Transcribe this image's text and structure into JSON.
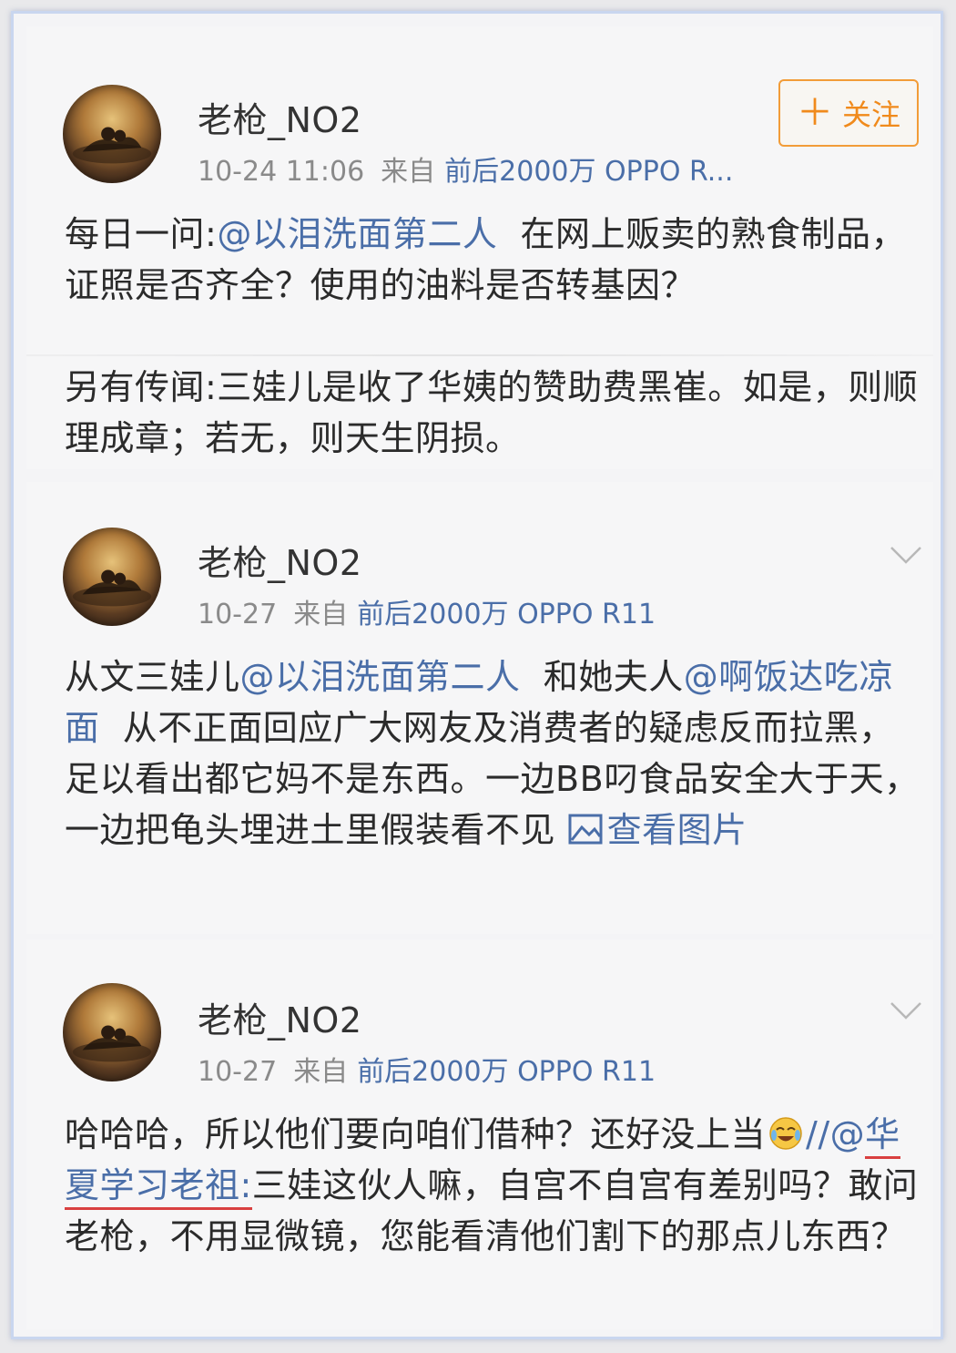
{
  "colors": {
    "link": "#4a6ea8",
    "follow": "#f08a1c",
    "underline": "#d94040",
    "meta": "#8a8a8a"
  },
  "posts": [
    {
      "username": "老枪_NO2",
      "time": "10-24 11:06",
      "source_label": "来自",
      "device": "前后2000万 OPPO R...",
      "follow_label": "关注",
      "body": {
        "p1_prefix": "每日一问:",
        "p1_mention": "@以泪洗面第二人",
        "p1_rest": "在网上贩卖的熟食制品，证照是否齐全？使用的油料是否转基因？",
        "p2": "另有传闻:三娃儿是收了华姨的赞助费黑崔。如是，则顺理成章；若无，则天生阴损。"
      }
    },
    {
      "username": "老枪_NO2",
      "time": "10-27",
      "source_label": "来自",
      "device": "前后2000万 OPPO R11",
      "body": {
        "prefix": "从文三娃儿",
        "mention1": "@以泪洗面第二人",
        "mid": "和她夫人",
        "mention2": "@啊饭达吃凉面",
        "rest": "从不正面回应广大网友及消费者的疑虑反而拉黑，足以看出都它妈不是东西。一边BB叼食品安全大于天，一边把龟头埋进土里假装看不见",
        "view_image": "查看图片"
      }
    },
    {
      "username": "老枪_NO2",
      "time": "10-27",
      "source_label": "来自",
      "device": "前后2000万 OPPO R11",
      "body": {
        "prefix": "哈哈哈，所以他们要向咱们借种？还好没上当",
        "slashes": "//",
        "mention_at": "@",
        "mention": "华夏学习老祖:",
        "rest": "三娃这伙人嘛，自宫不自宫有差别吗？敢问老枪，不用显微镜，您能看清他们割下的那点儿东西？"
      }
    }
  ]
}
